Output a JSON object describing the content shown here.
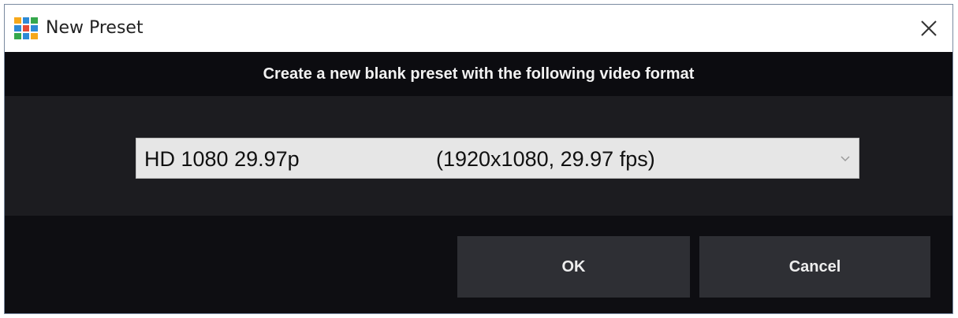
{
  "window": {
    "title": "New Preset",
    "app_icon": "grid-app-icon",
    "close_icon": "close-icon"
  },
  "dialog": {
    "heading": "Create a new blank preset with the following video format",
    "format_select": {
      "selected_name": "HD 1080 29.97p",
      "selected_spec": "(1920x1080, 29.97 fps)",
      "arrow_icon": "chevron-down-icon"
    },
    "buttons": {
      "ok_label": "OK",
      "cancel_label": "Cancel"
    }
  },
  "colors": {
    "header_background": "#0c0c10",
    "content_background": "#1c1c20",
    "button_background": "#2e2f34",
    "select_background": "#e6e6e6"
  }
}
